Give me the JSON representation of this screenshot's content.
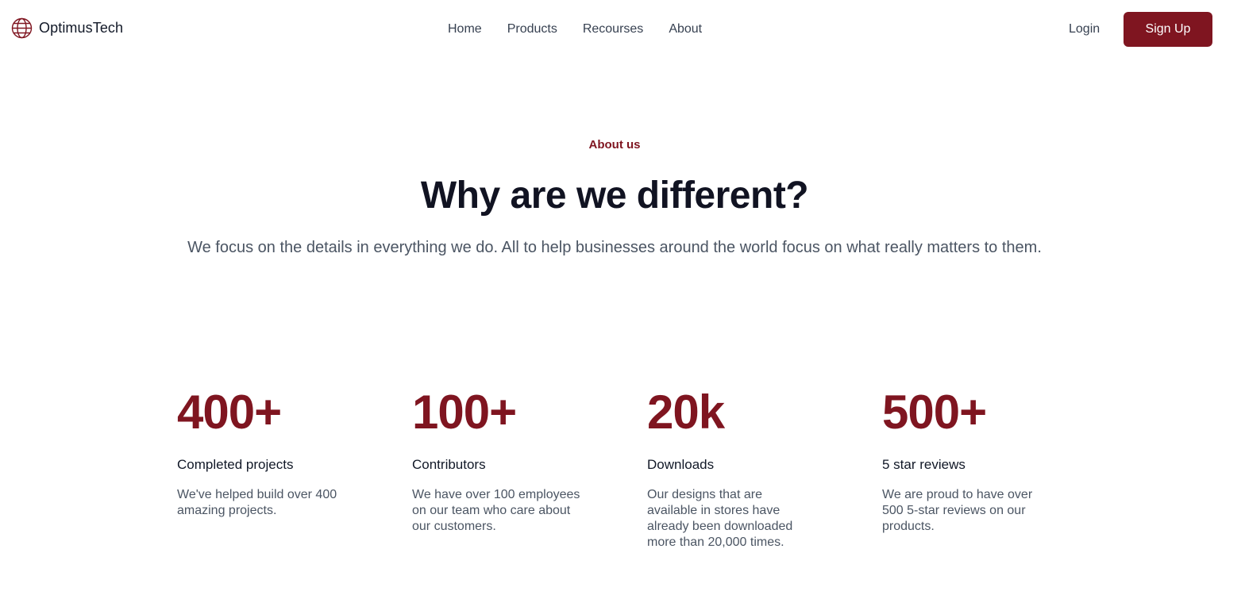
{
  "brand": {
    "name": "OptimusTech",
    "icon": "globe-icon",
    "accent_color": "#7f1520"
  },
  "nav": {
    "items": [
      {
        "label": "Home"
      },
      {
        "label": "Products"
      },
      {
        "label": "Recourses"
      },
      {
        "label": "About"
      }
    ]
  },
  "auth": {
    "login_label": "Login",
    "signup_label": "Sign Up"
  },
  "hero": {
    "eyebrow": "About us",
    "title": "Why are we different?",
    "subtitle": "We focus on the details in everything we do. All to help businesses around the world focus on what really matters to them."
  },
  "stats": [
    {
      "value": "400+",
      "label": "Completed projects",
      "description": "We've helped build over 400 amazing projects."
    },
    {
      "value": "100+",
      "label": "Contributors",
      "description": "We have over 100 employees on our team who care about our customers."
    },
    {
      "value": "20k",
      "label": "Downloads",
      "description": "Our designs that are available in stores have already been downloaded more than 20,000 times."
    },
    {
      "value": "500+",
      "label": "5 star reviews",
      "description": "We are proud to have over 500 5-star reviews on our products."
    }
  ]
}
